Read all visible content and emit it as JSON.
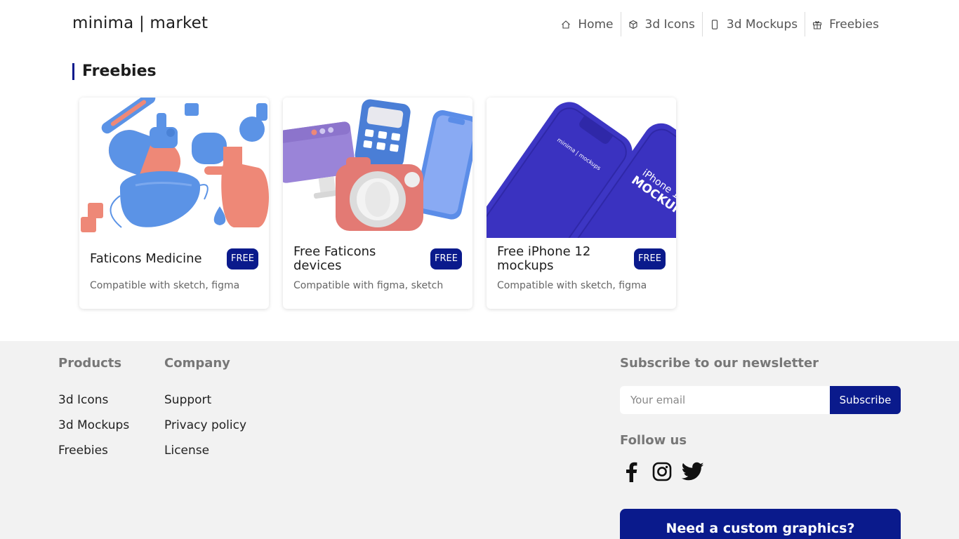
{
  "header": {
    "brand": "minima | market",
    "nav": [
      {
        "label": "Home",
        "icon": "home-icon"
      },
      {
        "label": "3d Icons",
        "icon": "cube-icon"
      },
      {
        "label": "3d Mockups",
        "icon": "phone-icon"
      },
      {
        "label": "Freebies",
        "icon": "gift-icon"
      }
    ]
  },
  "section": {
    "title": "Freebies"
  },
  "cards": [
    {
      "title": "Faticons Medicine",
      "badge": "FREE",
      "compat": "Compatible with sketch, figma"
    },
    {
      "title": "Free Faticons devices",
      "badge": "FREE",
      "compat": "Compatible with figma, sketch"
    },
    {
      "title": "Free iPhone 12 mockups",
      "badge": "FREE",
      "compat": "Compatible with sketch, figma"
    }
  ],
  "footer": {
    "products": {
      "heading": "Products",
      "links": [
        "3d Icons",
        "3d Mockups",
        "Freebies"
      ]
    },
    "company": {
      "heading": "Company",
      "links": [
        "Support",
        "Privacy policy",
        "License"
      ]
    },
    "newsletter": {
      "heading": "Subscribe to our newsletter",
      "placeholder": "Your email",
      "button": "Subscribe"
    },
    "follow": {
      "heading": "Follow us",
      "networks": [
        "facebook-icon",
        "instagram-icon",
        "twitter-icon"
      ]
    },
    "cta": "Need a custom graphics?"
  },
  "colors": {
    "accent": "#0a1a8c",
    "footer_bg": "#f2f2f2"
  }
}
